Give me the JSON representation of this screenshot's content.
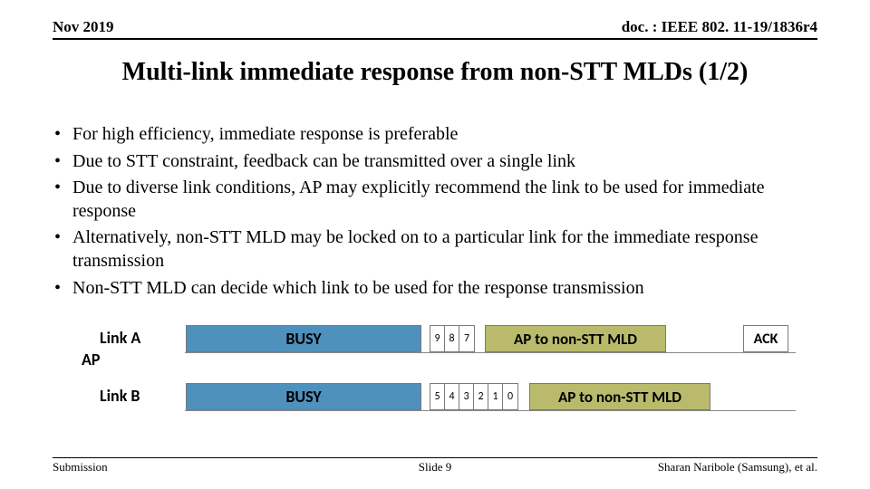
{
  "header": {
    "left": "Nov 2019",
    "right": "doc. : IEEE 802. 11-19/1836r4"
  },
  "title": "Multi-link immediate response from non-STT MLDs (1/2)",
  "bullets": [
    "For high efficiency, immediate response is preferable",
    "Due to STT constraint, feedback can be transmitted over a single link",
    "Due to diverse link conditions, AP may explicitly recommend the link to be used for immediate response",
    "Alternatively, non-STT MLD may be locked on to a particular link for the immediate response transmission",
    "Non-STT MLD can decide which link to be used for the response transmission"
  ],
  "diagram": {
    "ap_label": "AP",
    "rowA": {
      "link": "Link A",
      "busy": "BUSY",
      "count": [
        "9",
        "8",
        "7"
      ],
      "data": "AP to non-STT MLD",
      "ack": "ACK"
    },
    "rowB": {
      "link": "Link B",
      "busy": "BUSY",
      "count": [
        "5",
        "4",
        "3",
        "2",
        "1",
        "0"
      ],
      "data": "AP to non-STT MLD"
    }
  },
  "footer": {
    "left": "Submission",
    "center": "Slide 9",
    "right": "Sharan Naribole (Samsung), et al."
  }
}
